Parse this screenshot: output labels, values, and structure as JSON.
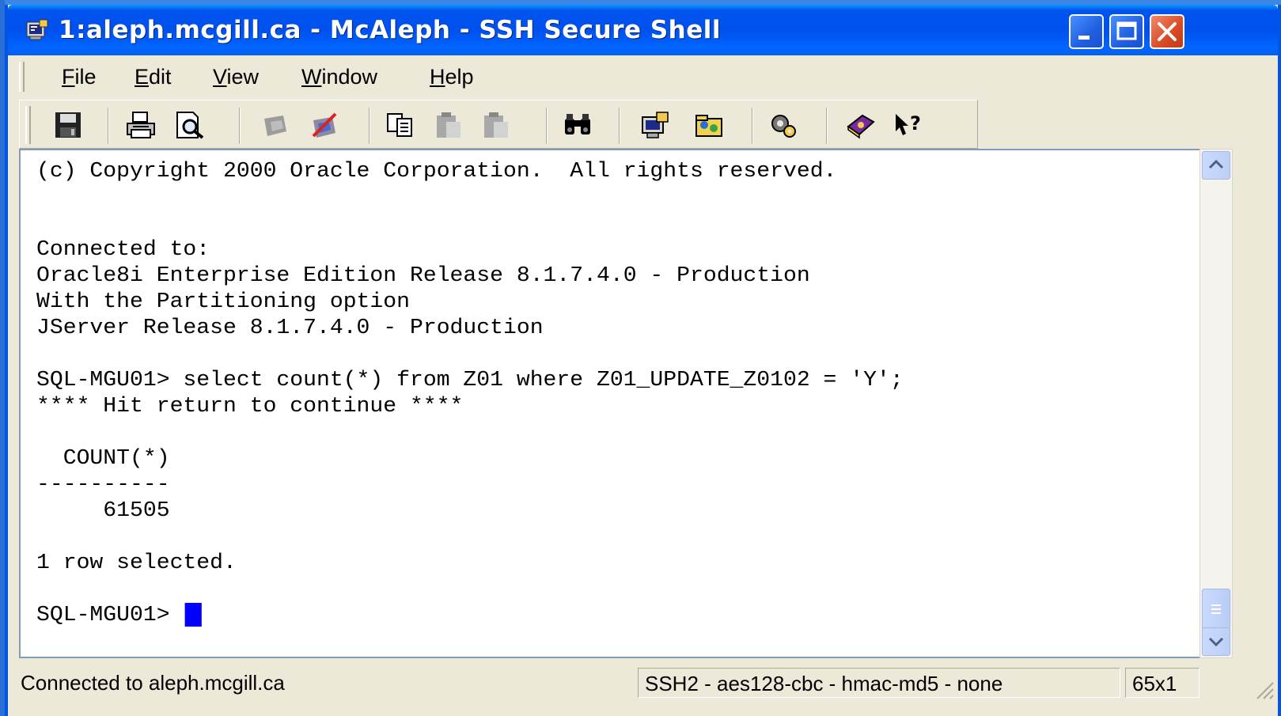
{
  "window": {
    "title": "1:aleph.mcgill.ca - McAleph - SSH Secure Shell",
    "buttons": {
      "minimize": "minimize",
      "maximize": "maximize",
      "close": "close"
    }
  },
  "menu": {
    "items": [
      {
        "label": "File",
        "u": "F",
        "rest": "ile"
      },
      {
        "label": "Edit",
        "u": "E",
        "rest": "dit"
      },
      {
        "label": "View",
        "u": "V",
        "rest": "iew"
      },
      {
        "label": "Window",
        "u": "W",
        "rest": "indow"
      },
      {
        "label": "Help",
        "u": "H",
        "rest": "elp"
      }
    ]
  },
  "toolbar": {
    "icons": [
      "save-icon",
      "print-icon",
      "print-preview-icon",
      "quick-connect-icon",
      "disconnect-icon",
      "copy-icon",
      "paste-icon",
      "paste-disabled-icon",
      "find-icon",
      "new-terminal-icon",
      "new-file-transfer-icon",
      "settings-icon",
      "help-book-icon",
      "whats-this-icon"
    ]
  },
  "terminal": {
    "lines": [
      "(c) Copyright 2000 Oracle Corporation.  All rights reserved.",
      "",
      "",
      "Connected to:",
      "Oracle8i Enterprise Edition Release 8.1.7.4.0 - Production",
      "With the Partitioning option",
      "JServer Release 8.1.7.4.0 - Production",
      "",
      "SQL-MGU01> select count(*) from Z01 where Z01_UPDATE_Z0102 = 'Y';",
      "**** Hit return to continue ****",
      "",
      "  COUNT(*)",
      "----------",
      "     61505",
      "",
      "1 row selected.",
      ""
    ],
    "prompt": "SQL-MGU01> ",
    "cursor_color": "#0000ff"
  },
  "status": {
    "connection": "Connected to aleph.mcgill.ca",
    "cipher": "SSH2 - aes128-cbc - hmac-md5 - none",
    "size": "65x1"
  },
  "colors": {
    "titlebar": "#0053ee",
    "chrome": "#ece9d8",
    "terminal_bg": "#ffffff",
    "terminal_fg": "#000000"
  }
}
